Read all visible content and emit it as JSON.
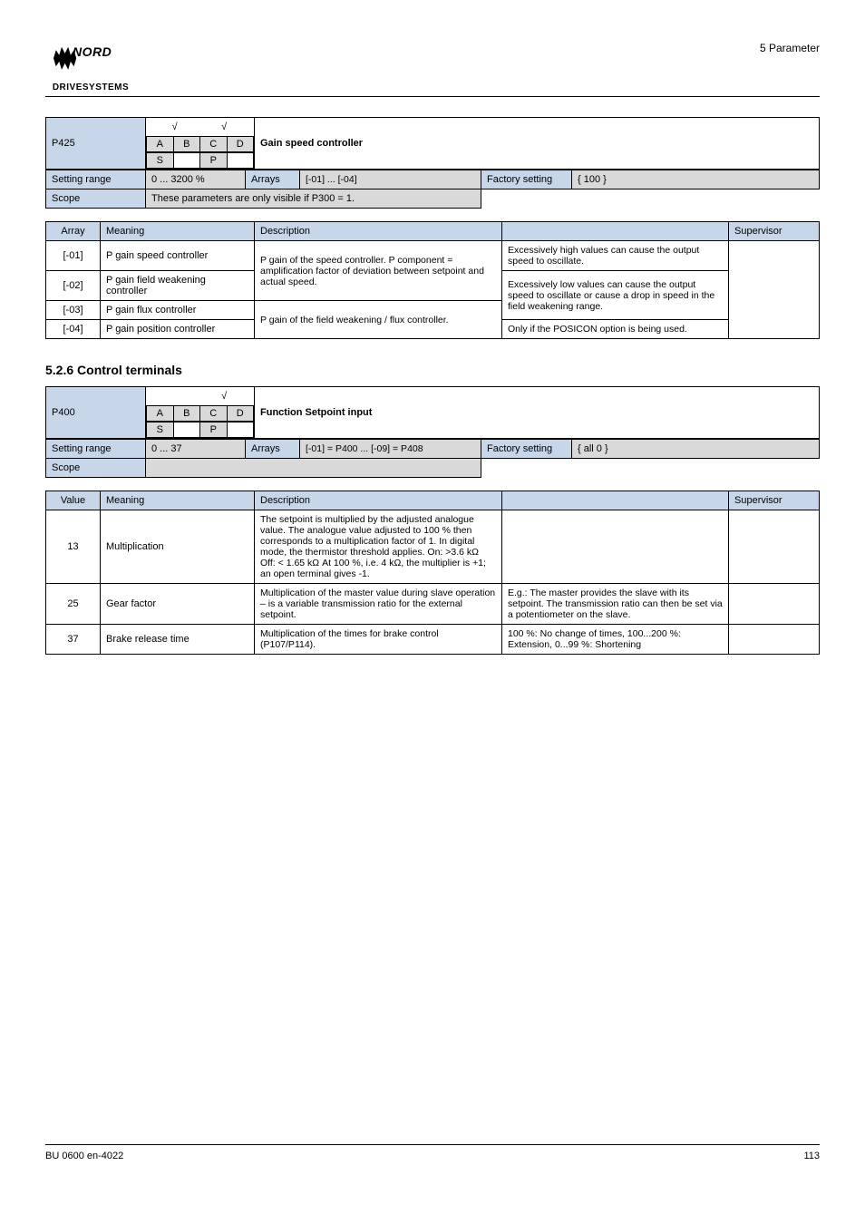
{
  "header": {
    "brand_top": "NORD",
    "brand_bottom": "DRIVESYSTEMS",
    "breadcrumb": "5 Parameter"
  },
  "p425": {
    "code": "P425",
    "tick1": "√",
    "tick2": "√",
    "name": "Gain speed controller",
    "abc": {
      "a": "A",
      "b": "B",
      "c": "C",
      "d": "D"
    },
    "sp": {
      "s": "S",
      "p": "P"
    },
    "rows": {
      "range_label": "Setting range",
      "range_value": "0 ... 3200 %",
      "arrays_label": "Arrays",
      "arrays_value": "[-01] ... [-04]",
      "factory_label": "Factory setting",
      "factory_value": "{ 100 }",
      "scope_label": "Scope",
      "scope_value": "These parameters are only visible if P300 = 1."
    },
    "meaning_header": {
      "array": "Array",
      "meaning": "Meaning",
      "description": "Description",
      "description2": "",
      "sup": "Supervisor"
    },
    "meaning_rows": [
      {
        "val": "[-01]",
        "meaning": "P gain speed controller",
        "desc1": "P gain of the speed controller. P component = amplification factor of deviation between setpoint and actual speed.",
        "desc2": "Excessively high values can cause the output speed to oscillate.",
        "sup": ""
      },
      {
        "val": "[-02]",
        "meaning": "P gain field weakening controller",
        "desc2": "",
        "sup": ""
      },
      {
        "val": "[-03]",
        "meaning": "P gain flux controller",
        "desc1_rowspan": "P gain of the field weakening / flux controller.",
        "desc2": "Excessively low values can cause the output speed to oscillate or cause a drop in speed in the field weakening range.",
        "sup": ""
      },
      {
        "val": "[-04]",
        "meaning": "P gain position controller",
        "desc2": "Only if the POSICON option is being used.",
        "sup": ""
      }
    ]
  },
  "section_title": "5.2.6 Control terminals",
  "p400": {
    "code": "P400",
    "tick1": "√",
    "tick2": "",
    "name": "Function Setpoint input",
    "abc": {
      "a": "A",
      "b": "B",
      "c": "C",
      "d": "D"
    },
    "sp": {
      "s": "S",
      "p": "P"
    },
    "rows": {
      "range_label": "Setting range",
      "range_value": "0 ... 37",
      "arrays_label": "Arrays",
      "arrays_value": "[-01] = P400 ... [-09] = P408",
      "factory_label": "Factory setting",
      "factory_value": "{ all 0 }",
      "scope_label": "Scope",
      "scope_value": ""
    },
    "meaning_header": {
      "array": "Value",
      "meaning": "Meaning",
      "description": "Description",
      "description2": "",
      "sup": "Supervisor"
    },
    "meaning_rows": [
      {
        "val": "13",
        "meaning": "Multiplication",
        "desc1": "The setpoint is multiplied by the adjusted analogue value. The analogue value adjusted to 100 % then corresponds to a multiplication factor of 1. In digital mode, the thermistor threshold applies. On: >3.6 kΩ Off: < 1.65 kΩ At 100 %, i.e. 4 kΩ, the multiplier is +1; an open terminal gives -1.",
        "desc2": "",
        "sup": ""
      },
      {
        "val": "25",
        "meaning": "Gear factor",
        "desc1": "Multiplication of the master value during slave operation – is a variable transmission ratio for the external setpoint.",
        "desc2": "E.g.: The master provides the slave with its setpoint. The transmission ratio can then be set via a potentiometer on the slave.",
        "sup": ""
      },
      {
        "val": "37",
        "meaning": "Brake release time",
        "desc1": "Multiplication of the times for brake control (P107/P114).",
        "desc2": "100  %: No change of times, 100...200 %: Extension, 0...99 %: Shortening",
        "sup": ""
      }
    ]
  },
  "footer": {
    "left": "BU 0600 en-4022",
    "right": "113"
  }
}
